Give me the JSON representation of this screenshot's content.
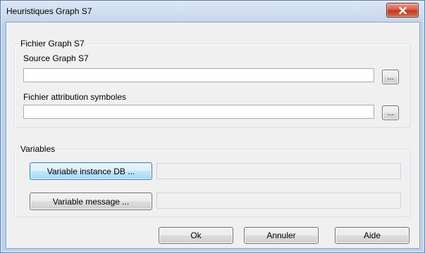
{
  "window": {
    "title": "Heuristiques Graph S7"
  },
  "group_file": {
    "title": "Fichier Graph S7",
    "source_label": "Source Graph S7",
    "source_value": "",
    "symbols_label": "Fichier attribution symboles",
    "symbols_value": "",
    "browse_label": "..."
  },
  "group_vars": {
    "title": "Variables",
    "instance_button": "Variable instance DB ...",
    "instance_value": "",
    "message_button": "Variable message ...",
    "message_value": ""
  },
  "footer": {
    "ok": "Ok",
    "cancel": "Annuler",
    "help": "Aide"
  }
}
